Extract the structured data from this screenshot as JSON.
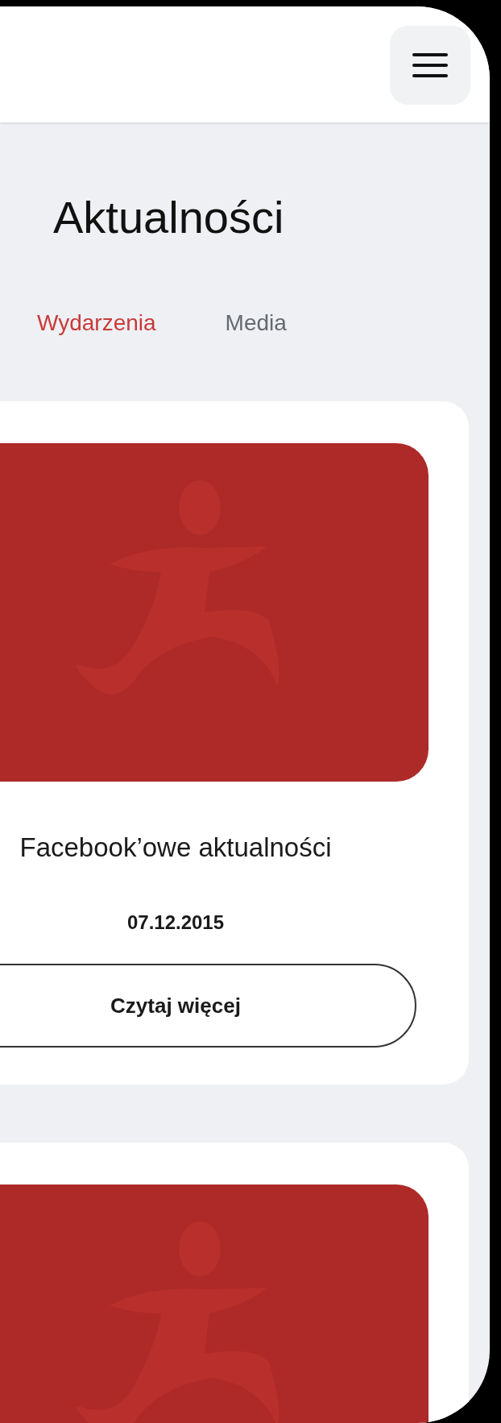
{
  "page_title": "Aktualności",
  "tabs": [
    {
      "label": "Wydarzenia",
      "selected": true
    },
    {
      "label": "Media",
      "selected": false
    }
  ],
  "posts": [
    {
      "image": {
        "kind": "picture"
      },
      "title": "Facebook’owe aktualności",
      "date": "07.12.2015",
      "button": "Czytaj więcej"
    },
    {
      "image": {
        "kind": "picture"
      }
    }
  ]
}
